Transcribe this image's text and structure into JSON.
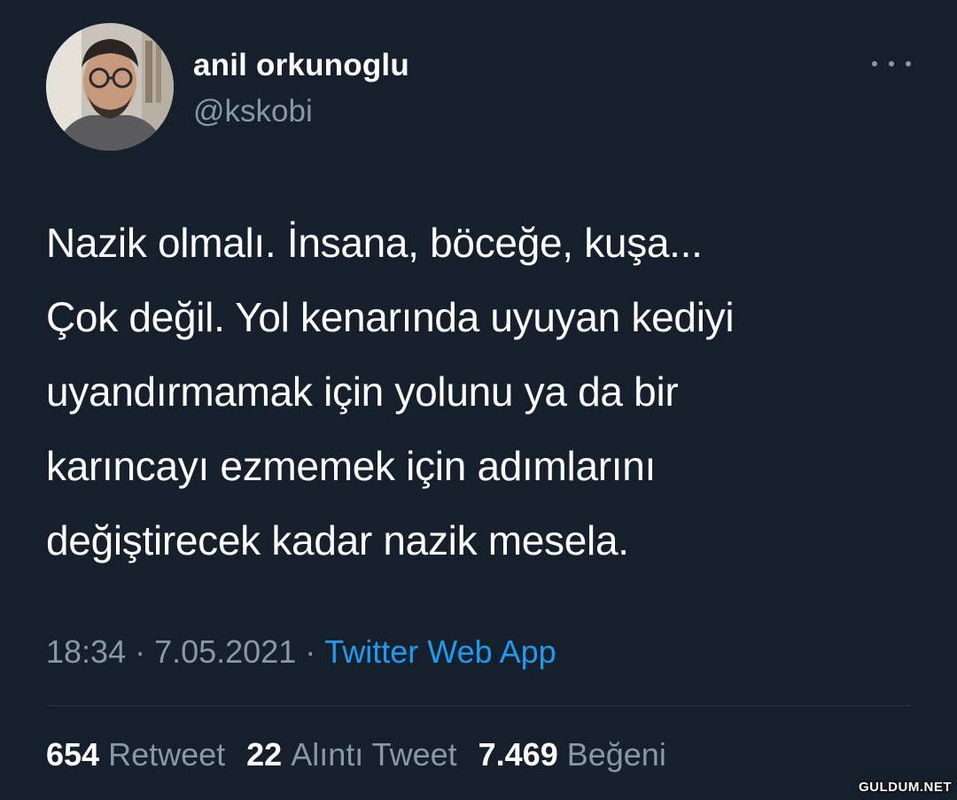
{
  "tweet": {
    "author": {
      "display_name": "anil orkunoglu",
      "handle": "@kskobi"
    },
    "more_icon": "more-horizontal-icon",
    "text": "Nazik olmalı. İnsana, böceğe, kuşa...\nÇok değil. Yol kenarında uyuyan kediyi\nuyandırmamak için yolunu ya da bir\nkarıncayı ezmemek için adımlarını\ndeğiştirecek kadar nazik mesela.",
    "meta": {
      "time": "18:34",
      "separator": "·",
      "date": "7.05.2021",
      "source": "Twitter Web App"
    },
    "stats": [
      {
        "count": "654",
        "label": "Retweet"
      },
      {
        "count": "22",
        "label": "Alıntı Tweet"
      },
      {
        "count": "7.469",
        "label": "Beğeni"
      }
    ]
  },
  "watermark": "GULDUM.NET",
  "colors": {
    "background": "#161f2c",
    "text_primary": "#ffffff",
    "text_secondary": "#8899a6",
    "link": "#1d9bf0",
    "divider": "#2f3b47"
  }
}
